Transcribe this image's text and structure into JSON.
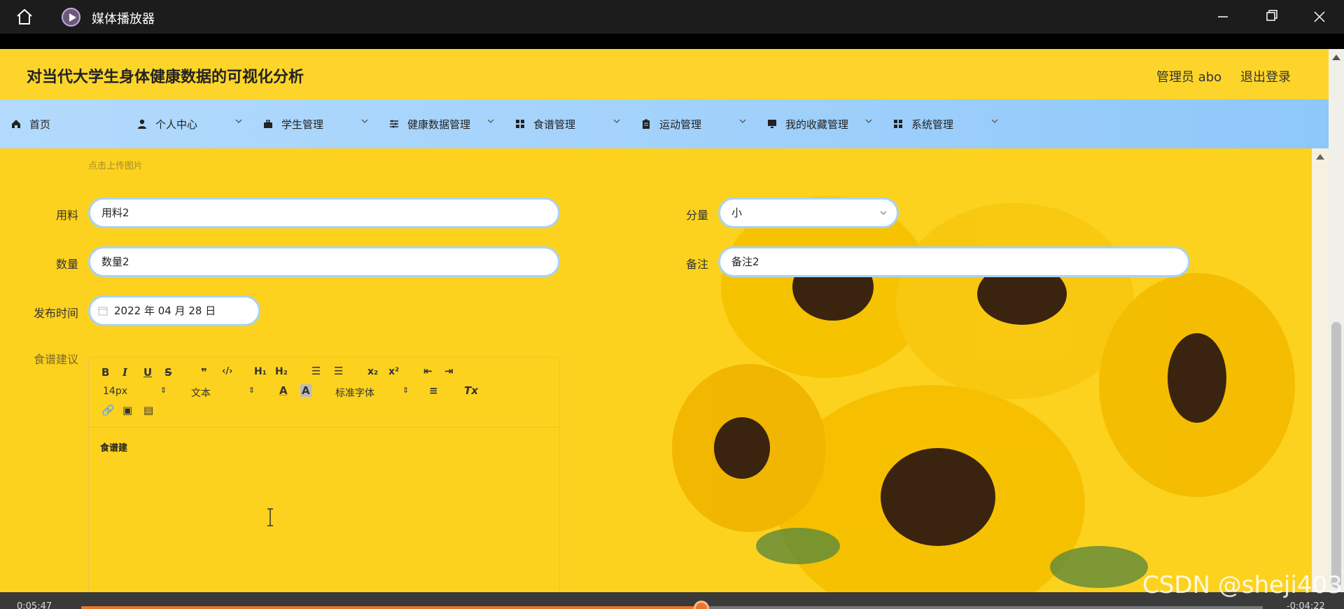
{
  "player": {
    "title": "媒体播放器",
    "time_elapsed": "0:05:47",
    "time_remaining": "-0:04:22",
    "progress_fraction": 0.525,
    "watermark": "CSDN @sheji403"
  },
  "header": {
    "site_title": "对当代大学生身体健康数据的可视化分析",
    "admin_label": "管理员 abo",
    "logout_label": "退出登录"
  },
  "nav": {
    "items": [
      {
        "label": "首页",
        "icon": "home-icon",
        "dropdown": false
      },
      {
        "label": "个人中心",
        "icon": "user-icon",
        "dropdown": true
      },
      {
        "label": "学生管理",
        "icon": "briefcase-icon",
        "dropdown": true
      },
      {
        "label": "健康数据管理",
        "icon": "sliders-icon",
        "dropdown": true
      },
      {
        "label": "食谱管理",
        "icon": "grid-icon",
        "dropdown": true
      },
      {
        "label": "运动管理",
        "icon": "clipboard-icon",
        "dropdown": true
      },
      {
        "label": "我的收藏管理",
        "icon": "monitor-icon",
        "dropdown": true
      },
      {
        "label": "系统管理",
        "icon": "grid-icon",
        "dropdown": true
      }
    ]
  },
  "form": {
    "upload_hint": "点击上传图片",
    "ingredients_label": "用料",
    "ingredients_value": "用料2",
    "portion_label": "分量",
    "portion_value": "小",
    "quantity_label": "数量",
    "quantity_value": "数量2",
    "note_label": "备注",
    "note_value": "备注2",
    "publish_time_label": "发布时间",
    "publish_time_value": "2022 年 04 月 28 日",
    "advice_label": "食谱建议"
  },
  "editor": {
    "font_size": "14px",
    "text_type": "文本",
    "font_family": "标准字体",
    "content": "食谱建"
  },
  "colors": {
    "page_bg": "#fcd21f",
    "nav_bg": "#a9d5fb",
    "input_border": "#a9d2f5",
    "progress": "#e8772e"
  }
}
